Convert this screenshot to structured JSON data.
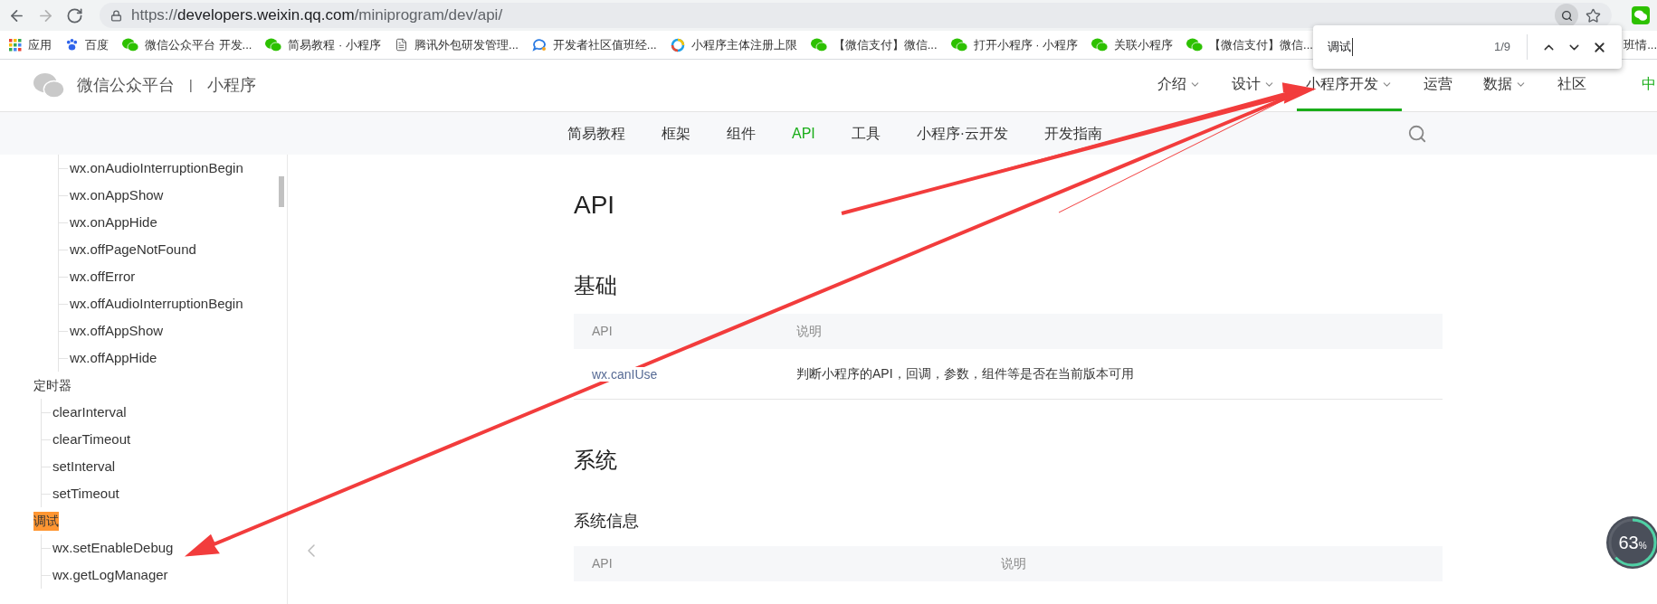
{
  "nav_buttons": [
    {
      "kind": "back",
      "disabled": false
    },
    {
      "kind": "forward",
      "disabled": true
    },
    {
      "kind": "reload",
      "disabled": false
    }
  ],
  "address_bar": {
    "scheme": "https://",
    "host": "developers.weixin.qq.com",
    "path": "/miniprogram/dev/api/"
  },
  "bookmarks": [
    {
      "kind": "apps",
      "label": "应用"
    },
    {
      "kind": "paw",
      "label": "百度"
    },
    {
      "kind": "wechat",
      "label": "微信公众平台 开发..."
    },
    {
      "kind": "wechat",
      "label": "简易教程 · 小程序"
    },
    {
      "kind": "doc",
      "label": "腾讯外包研发管理..."
    },
    {
      "kind": "chat",
      "label": "开发者社区值班经..."
    },
    {
      "kind": "ring",
      "label": "小程序主体注册上限"
    },
    {
      "kind": "wechat",
      "label": "【微信支付】微信..."
    },
    {
      "kind": "wechat",
      "label": "打开小程序 · 小程序"
    },
    {
      "kind": "wechat",
      "label": "关联小程序"
    },
    {
      "kind": "wechat",
      "label": "【微信支付】微信..."
    },
    {
      "kind": "plain",
      "label": "班情..."
    }
  ],
  "find_bar": {
    "value": "调试",
    "count": "1/9"
  },
  "site_header": {
    "brand": "微信公众平台",
    "separator": "|",
    "product": "小程序",
    "nav": [
      {
        "label": "介绍",
        "has_menu": true,
        "selected": false,
        "kind": "link"
      },
      {
        "label": "设计",
        "has_menu": true,
        "selected": false,
        "kind": "link"
      },
      {
        "label": "小程序开发",
        "has_menu": true,
        "selected": true,
        "kind": "link"
      },
      {
        "label": "运营",
        "has_menu": false,
        "selected": false,
        "kind": "link"
      },
      {
        "label": "数据",
        "has_menu": true,
        "selected": false,
        "kind": "link"
      },
      {
        "label": "社区",
        "has_menu": false,
        "selected": false,
        "kind": "link"
      },
      {
        "label": "中",
        "has_menu": false,
        "selected": false,
        "kind": "lang"
      }
    ]
  },
  "subnav": [
    {
      "label": "简易教程",
      "selected": false
    },
    {
      "label": "框架",
      "selected": false
    },
    {
      "label": "组件",
      "selected": false
    },
    {
      "label": "API",
      "selected": true
    },
    {
      "label": "工具",
      "selected": false
    },
    {
      "label": "小程序·云开发",
      "selected": false
    },
    {
      "label": "开发指南",
      "selected": false
    }
  ],
  "sidebar": {
    "sections": [
      {
        "items": [
          "wx.onAudioInterruptionBegin",
          "wx.onAppShow",
          "wx.onAppHide",
          "wx.offPageNotFound",
          "wx.offError",
          "wx.offAudioInterruptionBegin",
          "wx.offAppShow",
          "wx.offAppHide"
        ]
      },
      {
        "label": "定时器",
        "highlighted": false,
        "items": [
          "clearInterval",
          "clearTimeout",
          "setInterval",
          "setTimeout"
        ]
      },
      {
        "label": "调试",
        "highlighted": true,
        "items": [
          "wx.setEnableDebug",
          "wx.getLogManager"
        ]
      }
    ]
  },
  "content": {
    "title": "API",
    "blocks": [
      {
        "kind": "h2",
        "text": "基础"
      },
      {
        "kind": "table",
        "columns": [
          "API",
          "说明"
        ],
        "rows": [
          [
            {
              "text": "wx.canIUse",
              "link": true
            },
            {
              "text": "判断小程序的API，回调，参数，组件等是否在当前版本可用",
              "link": false
            }
          ]
        ]
      },
      {
        "kind": "h2",
        "text": "系统"
      },
      {
        "kind": "h3",
        "text": "系统信息"
      },
      {
        "kind": "table",
        "columns": [
          "API",
          "说明"
        ]
      }
    ]
  },
  "percent_widget": {
    "value": "63",
    "unit": "%",
    "level": 0.63
  }
}
